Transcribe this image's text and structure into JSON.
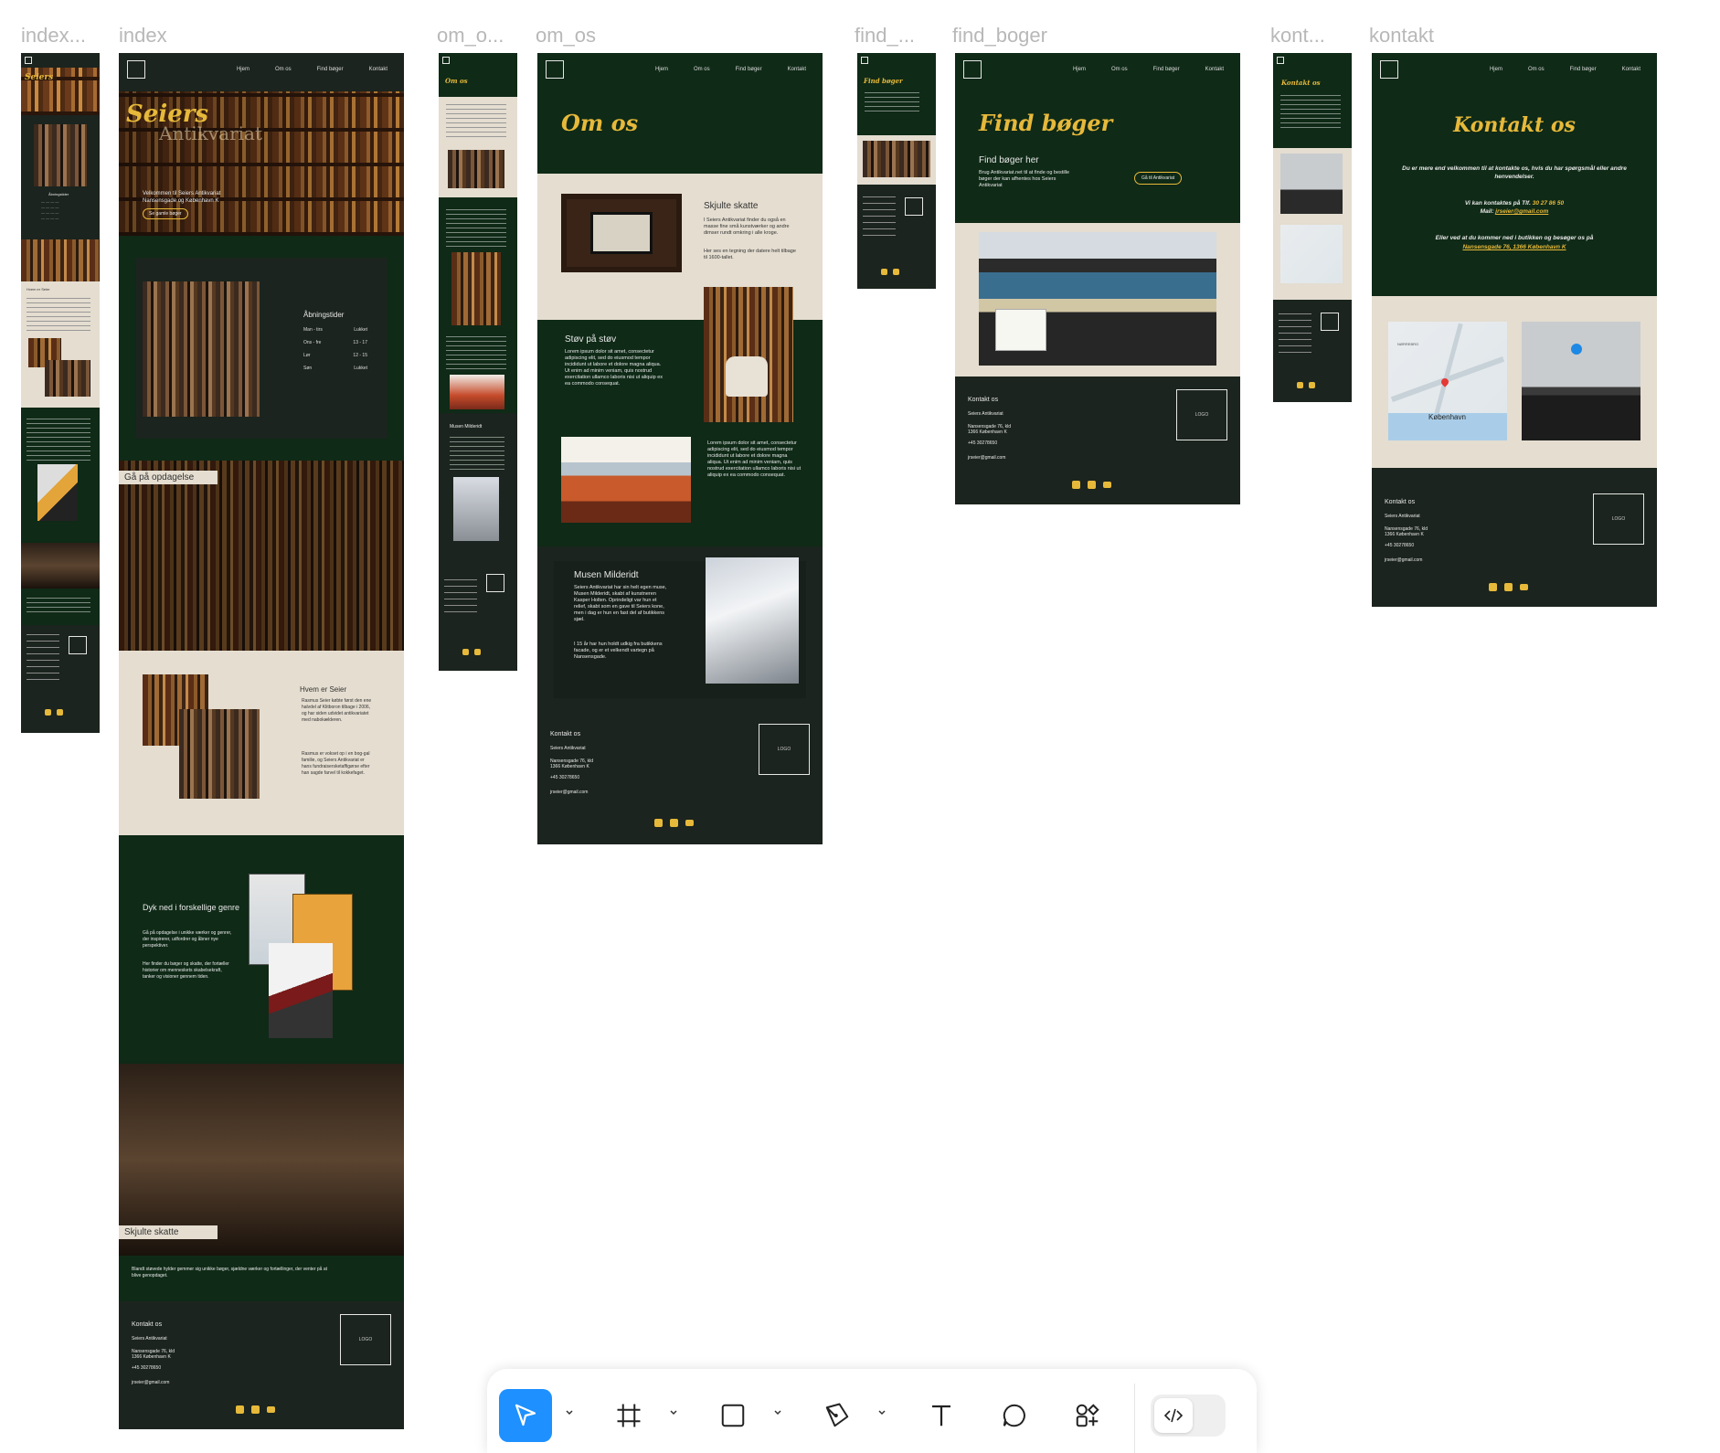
{
  "frame_labels": [
    "index...",
    "index",
    "om_o...",
    "om_os",
    "find_...",
    "find_boger",
    "kont...",
    "kontakt"
  ],
  "nav": {
    "links": [
      "Hjem",
      "Om os",
      "Find bøger",
      "Kontakt"
    ]
  },
  "index": {
    "hero_title": "Seiers",
    "hero_sub": "Antikvariat",
    "hero_text": "Velkommen til Seiers Antikvariat\nNansensgade og København K",
    "hero_btn": "Se gamle bøger",
    "hours_title": "Åbningstider",
    "hours": [
      {
        "day": "Man - tirs",
        "time": "Lukket"
      },
      {
        "day": "Ons - fre",
        "time": "13 - 17"
      },
      {
        "day": "Lør",
        "time": "12 - 15"
      },
      {
        "day": "Søn",
        "time": "Lukket"
      }
    ],
    "explore_tag": "Gå på opdagelse",
    "who_title": "Hvem er Seier",
    "who_p1": "Rasmus Seier købte først den ene halvdel af Klitboron tilbage i 2006, og har siden udvidet antikvariatet med nabokælderen.",
    "who_p2": "Rasmus er vokset op i en bog-gal familie, og Seiers Antikvariat er hans fundraisersketaffigørse efter han sagde farvel til kokkefaget.",
    "genre_title": "Dyk ned i forskellige genre",
    "genre_p1": "Gå på opdagelse i unikke værker og genrer, der inspirerer, udfordrer og åbner nye perspektiver.",
    "genre_p2": "Her finder du bøger og skatte, der fortæller historier om menneskets skabelsekraft, tanker og visioner gennem tiden.",
    "hidden_tag": "Skjulte skatte",
    "hidden_text": "Blandt støvede hylder gemmer sig unikke bøger, sjældne værker og fortællinger, der venter på at blive genopdaget."
  },
  "footer": {
    "title": "Kontakt os",
    "name": "Seiers Antikvariat",
    "address": "Nansensgade 76, kld\n1366 København K",
    "phone": "+45 30278650",
    "email": "jrseier@gmail.com",
    "logo": "LOGO"
  },
  "om_os": {
    "title": "Om os",
    "s1_title": "Skjulte skatte",
    "s1_p1": "I Seiers Antikvariat finder du også en masse fine små kunstværker og andre dimser rundt omkring i alle kroge.",
    "s1_p2": "Her ses en tegning der datere helt tilbage til 1600-tallet.",
    "s2_title": "Støv på støv",
    "s2_p": "Lorem ipsum dolor sit amet, consectetur adipiscing elit, sed do eiusmod tempor incididunt ut labore et dolore magna aliqua. Ut enim ad minim veniam, quis nostrud exercitation ullamco laboris nisi ut aliquip ex ea commodo consequat.",
    "s3_p": "Lorem ipsum dolor sit amet, consectetur adipiscing elit, sed do eiusmod tempor incididunt ut labore et dolore magna aliqua. Ut enim ad minim veniam, quis nostrud exercitation ullamco laboris nisi ut aliquip ex ea commodo consequat.",
    "s4_title": "Musen Milderidt",
    "s4_p1": "Seiers Antikvariat har sin helt egen muse, Musen Milderidt, skabt af kunstneren Kasper Holten. Oprindeligt var hun et relief, skabt som en gave til Seiers kone, men i dag er hun en fast del af butikkens sjæl.",
    "s4_p2": "I 15 år har hun holdt udkig fra butikkens facade, og er et velkendt vartegn på Nansensgade."
  },
  "find_boger": {
    "title": "Find bøger",
    "sub": "Find bøger her",
    "text": "Brug Antikvariat.net til at finde og bestille bøger der kan afhentes hos Seiers Antikvariat",
    "btn": "Gå til Antikvariat"
  },
  "kontakt": {
    "title": "Kontakt os",
    "p1": "Du er mere end velkommen til at kontakte os, hvis du har spørgsmål eller andre henvendelser.",
    "p2a": "Vi kan kontaktes på Tlf.",
    "phone": "30 27 86 50",
    "p2b": "Mail:",
    "mail": "jrseier@gmail.com",
    "p3": "Eller ved at du kommer ned i butikken og besøger os på",
    "address": "Nansensgade 76, 1366 København K",
    "map_label": "København",
    "map_label2": "NØRREBRO"
  },
  "toolbar": {
    "tools": [
      "move-tool",
      "frame-tool",
      "rectangle-tool",
      "pen-tool",
      "text-tool",
      "comment-tool",
      "actions-tool",
      "dev-mode-toggle"
    ]
  },
  "colors": {
    "dark_green": "#0f2a17",
    "dark": "#1b241e",
    "cream": "#e4ddd0",
    "gold": "#e7b93a",
    "accent_blue": "#1e90ff"
  }
}
